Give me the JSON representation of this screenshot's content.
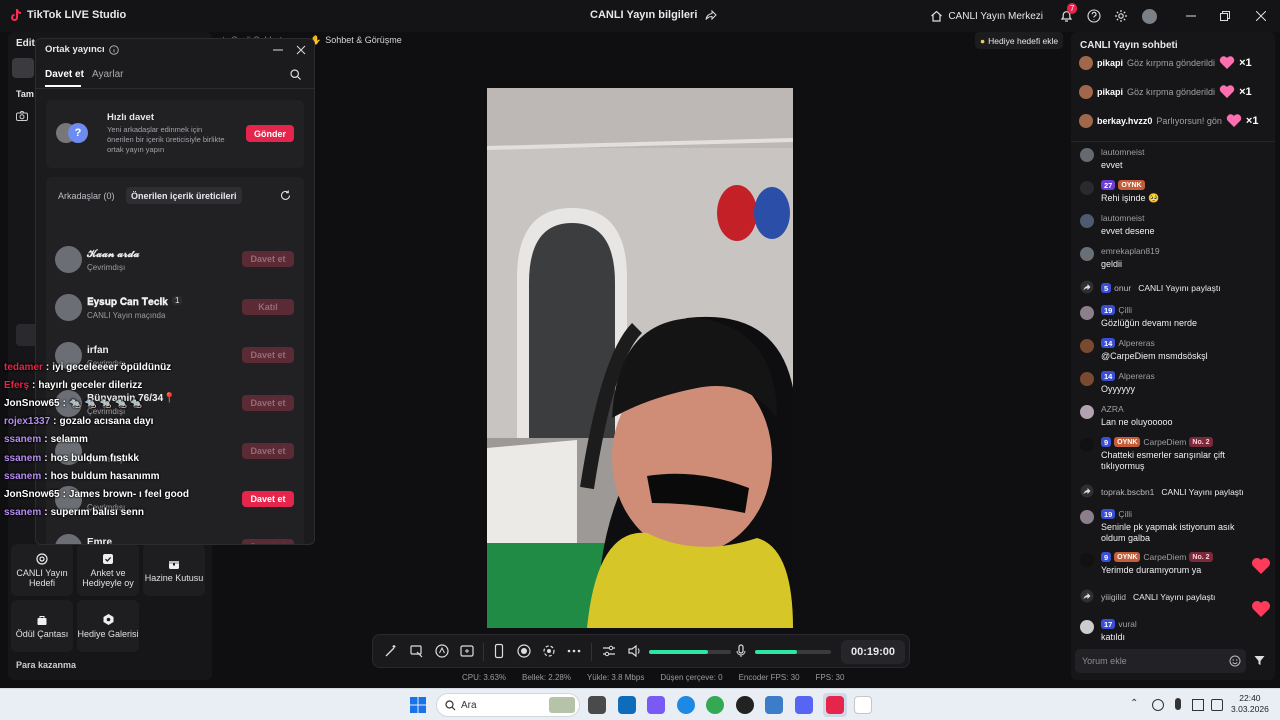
{
  "app": {
    "title": "TikTok LIVE Studio",
    "center_title": "CANLI Yayın bilgileri",
    "live_center": "CANLI Yayın Merkezi",
    "notification_count": "7"
  },
  "left_panel": {
    "edit_label": "Edit",
    "section_label": "Tam",
    "tools": [
      {
        "label": "CANLI Yayın Hedefi",
        "icon": "target-icon"
      },
      {
        "label": "Anket ve Hediyeyle oy",
        "icon": "poll-icon"
      },
      {
        "label": "Hazine Kutusu",
        "icon": "treasure-icon"
      },
      {
        "label": "Ödül Çantası",
        "icon": "reward-bag-icon"
      },
      {
        "label": "Hediye Galerisi",
        "icon": "gift-gallery-icon"
      }
    ],
    "footer_label": "Para kazanma"
  },
  "scene_bar": {
    "chip1": "Sesli Sohbet",
    "chip2": "Sohbet & Görüşme",
    "gift_goal": "Hediye hedefi ekle"
  },
  "popup": {
    "title": "Ortak yayıncı",
    "tabs": [
      "Davet et",
      "Ayarlar"
    ],
    "quick_invite": {
      "title": "Hızlı davet",
      "description": "Yeni arkadaşlar edinmek için önerilen bir içerik üreticisiyle birlikte ortak yayın yapın",
      "button": "Gönder"
    },
    "subtabs": [
      "Arkadaşlar (0)",
      "Önerilen içerik üreticileri"
    ],
    "rows": [
      {
        "name": "𝓚𝓪𝓪𝓷 𝓪𝓻𝓭𝓪",
        "status": "Çevrimdışı",
        "button": "Davet et",
        "active": false
      },
      {
        "name": "𝐄𝐲𝐬𝐮𝐩 𝐂𝐚𝐧 𝐓𝐞𝐜𝐢𝐤",
        "badge": "1",
        "status": "CANLI Yayın maçında",
        "button": "Katıl",
        "active": false
      },
      {
        "name": "irfan",
        "status": "Çevrimdışı",
        "button": "Davet et",
        "active": false
      },
      {
        "name": "Bünyamin 76/34📍",
        "status": "Çevrimdışı",
        "button": "Davet et",
        "active": false
      },
      {
        "name": "",
        "status": "Çevrimdışı",
        "button": "Davet et",
        "active": false
      },
      {
        "name": "",
        "status": "Çevrimdışı",
        "button": "Davet et",
        "active": true
      },
      {
        "name": "Emre",
        "status": "Çevrimdışı",
        "button": "Davet et",
        "active": false
      }
    ]
  },
  "overlay_chat": [
    {
      "user": "tedamer",
      "text": "iyi geceleeeer öpüldünüz",
      "color": "#e5254b"
    },
    {
      "user": "Eferş",
      "text": "hayırlı geceler dilerizz",
      "color": "#e5254b"
    },
    {
      "user": "JonSnow65",
      "text": "🐀 🐀 🐀 🐀 🐀",
      "color": "#ffffff"
    },
    {
      "user": "rojex1337",
      "text": "gozalo acısana dayı",
      "color": "#b58cf0"
    },
    {
      "user": "ssanem",
      "text": "selamm",
      "color": "#b58cf0"
    },
    {
      "user": "ssanem",
      "text": "hos buldum fıstıkk",
      "color": "#b58cf0"
    },
    {
      "user": "ssanem",
      "text": "hos buldum hasanımm",
      "color": "#b58cf0"
    },
    {
      "user": "JonSnow65",
      "text": "James brown- ı feel good",
      "color": "#ffffff"
    },
    {
      "user": "ssanem",
      "text": "superım balısı senn",
      "color": "#b58cf0"
    }
  ],
  "chat": {
    "title": "CANLI Yayın sohbeti",
    "gifts": [
      {
        "user": "pikapi",
        "action": "Göz kırpma gönderildi",
        "count": "×1"
      },
      {
        "user": "pikapi",
        "action": "Göz kırpma gönderildi",
        "count": "×1"
      },
      {
        "user": "berkay.hvzz0",
        "action": "Parlıyorsun! gön",
        "count": "×1"
      }
    ],
    "messages": [
      {
        "user": "lautomneist",
        "text": "evvet"
      },
      {
        "user": "",
        "level": "27",
        "team": "OYNK",
        "text": "Rehi işinde 🥺"
      },
      {
        "user": "lautomneist",
        "text": "evvet desene"
      },
      {
        "user": "emrekaplan819",
        "text": "geldii"
      },
      {
        "user": "onur",
        "level": "5",
        "text": "CANLI Yayını paylaştı",
        "share": true
      },
      {
        "user": "Çilli",
        "level": "19",
        "text": "Gözlüğün devamı nerde"
      },
      {
        "user": "Alpereras",
        "level": "14",
        "text": "@CarpeDiem msmdsöskşl"
      },
      {
        "user": "Alpereras",
        "level": "14",
        "text": "Oyyyyyy"
      },
      {
        "user": "AZRA",
        "text": "Lan ne oluyooooo"
      },
      {
        "user": "CarpeDiem",
        "level": "9",
        "team": "OYNK",
        "rank": "No. 2",
        "text": "Chatteki esmerler sarışınlar çift tıklıyormuş"
      },
      {
        "user": "toprak.bscbn1",
        "text": "CANLI Yayını paylaştı",
        "share": true
      },
      {
        "user": "Çilli",
        "level": "19",
        "text": "Seninle pk yapmak istiyorum asık oldum galba"
      },
      {
        "user": "CarpeDiem",
        "level": "9",
        "team": "OYNK",
        "rank": "No. 2",
        "text": "Yerimde duramıyorum ya"
      },
      {
        "user": "yiiigilid",
        "text": "CANLI Yayını paylaştı",
        "share": true
      },
      {
        "user": "vural",
        "level": "17",
        "text": "katıldı"
      }
    ],
    "input_placeholder": "Yorum ekle"
  },
  "controls": {
    "timer": "00:19:00",
    "volume_level": 0.72,
    "mic_level": 0.55
  },
  "stats": {
    "cpu": "CPU: 3.63%",
    "memory": "Bellek: 2.28%",
    "upload": "Yükle: 3.8 Mbps",
    "dropped": "Düşen çerçeve: 0",
    "encoder_fps": "Encoder FPS: 30",
    "fps": "FPS: 30"
  },
  "taskbar": {
    "search": "Ara",
    "time": "22:40",
    "date": "3.03.2026"
  },
  "colors": {
    "accent": "#e5254b",
    "background": "#0f0f11",
    "panel": "#161618",
    "level_badge": "#3a4fd8"
  }
}
